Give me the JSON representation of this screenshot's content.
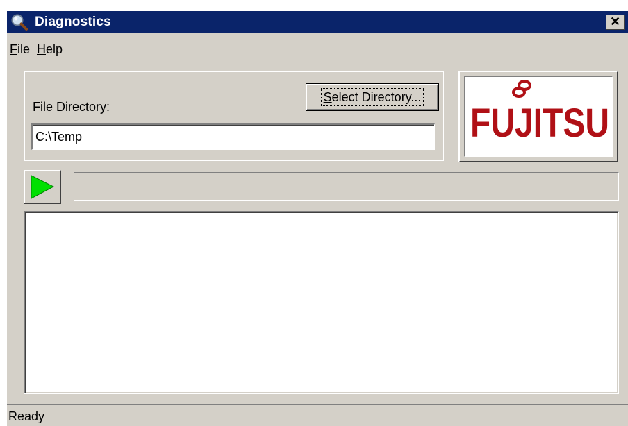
{
  "window": {
    "title": "Diagnostics",
    "title_icon": "magnifier-icon",
    "close_glyph": "✕"
  },
  "menu": {
    "file_mnemonic": "F",
    "file_rest": "ile",
    "help_mnemonic": "H",
    "help_rest": "elp"
  },
  "directory": {
    "label_prefix": "File ",
    "label_mnemonic": "D",
    "label_rest": "irectory:",
    "value": "C:\\Temp",
    "select_button_mnemonic": "S",
    "select_button_rest": "elect Directory..."
  },
  "logo": {
    "text": "FUJITSU",
    "color": "#b01016"
  },
  "run": {
    "play_icon": "play-icon",
    "play_color": "#00e000",
    "progress": 0
  },
  "log": {
    "content": ""
  },
  "status": {
    "text": "Ready"
  }
}
